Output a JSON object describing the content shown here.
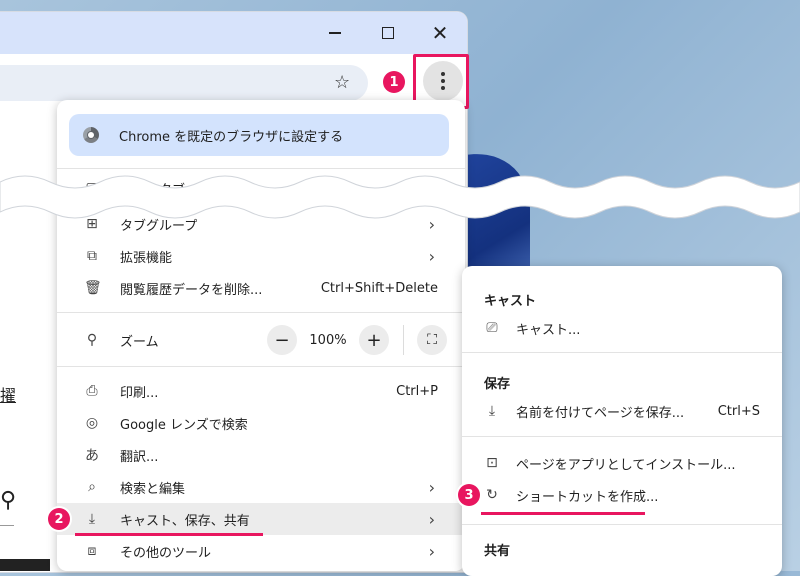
{
  "colors": {
    "accent": "#e8165f",
    "banner": "#d3e3fd",
    "titlebar": "#d7e3fb"
  },
  "window": {
    "controls": {
      "minimize_icon": "minimize-icon",
      "maximize_icon": "maximize-icon",
      "close_icon": "close-icon",
      "close_glyph": "✕"
    },
    "toolbar": {
      "star_glyph": "☆"
    },
    "left_page": {
      "fragment_char": "擢",
      "search_glyph": "⚲"
    }
  },
  "steps": {
    "s1": "1",
    "s2": "2",
    "s3": "3"
  },
  "menu": {
    "banner_label": "Chrome を既定のブラウザに設定する",
    "partial_item": "新しいタブ",
    "items": [
      {
        "label": "タブグループ",
        "icon": "tab-groups-icon",
        "glyph": "⊞",
        "chevron": "›"
      },
      {
        "label": "拡張機能",
        "icon": "extension-icon",
        "glyph": "⧉",
        "chevron": "›"
      },
      {
        "label": "閲覧履歴データを削除...",
        "icon": "trash-icon",
        "glyph": "🗑",
        "shortcut": "Ctrl+Shift+Delete"
      }
    ],
    "zoom": {
      "label": "ズーム",
      "icon": "zoom-icon",
      "glyph": "⚲",
      "minus": "−",
      "value": "100%",
      "plus": "+",
      "fullscreen_glyph": "⛶"
    },
    "items2": [
      {
        "label": "印刷...",
        "icon": "print-icon",
        "glyph": "⎙",
        "shortcut": "Ctrl+P"
      },
      {
        "label": "Google レンズで検索",
        "icon": "lens-icon",
        "glyph": "◎"
      },
      {
        "label": "翻訳...",
        "icon": "translate-icon",
        "glyph": "あ"
      },
      {
        "label": "検索と編集",
        "icon": "find-icon",
        "glyph": "⌕",
        "chevron": "›"
      },
      {
        "label": "キャスト、保存、共有",
        "icon": "save-file-icon",
        "glyph": "⤓",
        "chevron": "›"
      },
      {
        "label": "その他のツール",
        "icon": "toolbox-icon",
        "glyph": "⧈",
        "chevron": "›"
      }
    ]
  },
  "submenu": {
    "cast_header": "キャスト",
    "cast_item": {
      "label": "キャスト...",
      "icon": "cast-icon",
      "glyph": "⎚"
    },
    "save_header": "保存",
    "save_item": {
      "label": "名前を付けてページを保存...",
      "icon": "save-page-icon",
      "glyph": "⤓",
      "shortcut": "Ctrl+S"
    },
    "install_item": {
      "label": "ページをアプリとしてインストール...",
      "icon": "install-app-icon",
      "glyph": "⊡"
    },
    "shortcut_item": {
      "label": "ショートカットを作成...",
      "icon": "shortcut-icon",
      "glyph": "↻"
    },
    "share_header": "共有"
  }
}
